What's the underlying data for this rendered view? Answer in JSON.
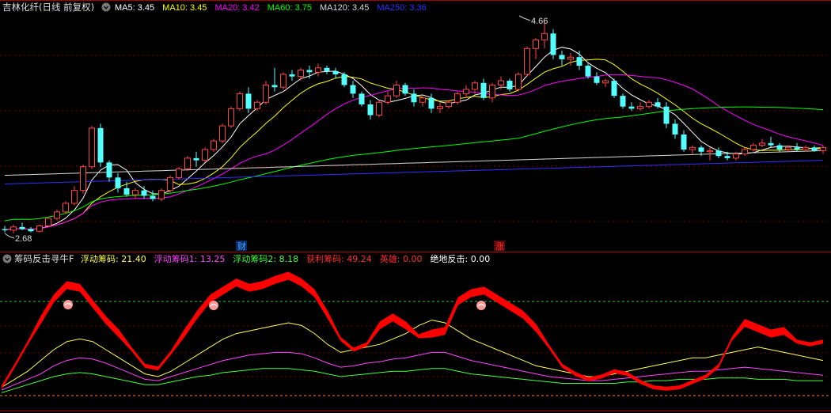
{
  "main_panel": {
    "title": "吉林化纤(日线 前复权)",
    "ma_legend": [
      {
        "label": "MA5: ",
        "value": "3.45",
        "color": "#ffffff"
      },
      {
        "label": "MA10: ",
        "value": "3.45",
        "color": "#ffff00"
      },
      {
        "label": "MA20: ",
        "value": "3.42",
        "color": "#ff00ff"
      },
      {
        "label": "MA60: ",
        "value": "3.75",
        "color": "#00ff00"
      },
      {
        "label": "MA120: ",
        "value": "3.45",
        "color": "#d8d8d8"
      },
      {
        "label": "MA250: ",
        "value": "3.36",
        "color": "#3030ff"
      }
    ],
    "high_label": "4.66",
    "low_label": "2.68",
    "markers": [
      {
        "text": "财",
        "color": "#44aaff"
      },
      {
        "text": "涨",
        "color": "#ff3030"
      }
    ]
  },
  "sub_panel": {
    "title": "筹码反击寻牛F",
    "legend": [
      {
        "label": "浮动筹码: ",
        "value": "21.40",
        "color": "#ffff55"
      },
      {
        "label": "浮动筹码1: ",
        "value": "13.25",
        "color": "#ff44ff"
      },
      {
        "label": "浮动筹码2: ",
        "value": "8.18",
        "color": "#44ff44"
      },
      {
        "label": "获利筹码: ",
        "value": "49.24",
        "color": "#ff3030"
      },
      {
        "label": "英雄: ",
        "value": "0.00",
        "color": "#ff3030"
      },
      {
        "label": "绝地反击: ",
        "value": "0.00",
        "color": "#ffffff"
      }
    ]
  },
  "colors": {
    "up": "#ff4444",
    "down": "#54ffff",
    "grid": "#7a0000",
    "profit": "#ff0000",
    "level_line": "#22cc22",
    "base_line": "#ff8800"
  },
  "chart_data": [
    {
      "type": "candlestick",
      "title": "吉林化纤(日线 前复权)",
      "price_max": 4.66,
      "price_min": 2.68,
      "ohlc": [
        [
          2.72,
          2.75,
          2.69,
          2.71
        ],
        [
          2.71,
          2.76,
          2.68,
          2.74
        ],
        [
          2.74,
          2.78,
          2.71,
          2.72
        ],
        [
          2.72,
          2.74,
          2.69,
          2.7
        ],
        [
          2.7,
          2.76,
          2.69,
          2.75
        ],
        [
          2.75,
          2.83,
          2.74,
          2.82
        ],
        [
          2.82,
          2.9,
          2.8,
          2.88
        ],
        [
          2.88,
          2.98,
          2.86,
          2.96
        ],
        [
          2.96,
          3.12,
          2.94,
          3.08
        ],
        [
          3.08,
          3.32,
          3.05,
          3.3
        ],
        [
          3.3,
          3.68,
          3.28,
          3.66
        ],
        [
          3.66,
          3.7,
          3.3,
          3.34
        ],
        [
          3.34,
          3.36,
          3.16,
          3.2
        ],
        [
          3.2,
          3.24,
          3.06,
          3.1
        ],
        [
          3.1,
          3.16,
          3.02,
          3.04
        ],
        [
          3.04,
          3.1,
          3.0,
          3.08
        ],
        [
          3.08,
          3.12,
          3.0,
          3.03
        ],
        [
          3.03,
          3.08,
          2.98,
          3.0
        ],
        [
          3.0,
          3.1,
          2.98,
          3.08
        ],
        [
          3.08,
          3.22,
          3.06,
          3.2
        ],
        [
          3.2,
          3.3,
          3.18,
          3.28
        ],
        [
          3.28,
          3.4,
          3.26,
          3.38
        ],
        [
          3.38,
          3.44,
          3.3,
          3.36
        ],
        [
          3.36,
          3.48,
          3.34,
          3.46
        ],
        [
          3.46,
          3.56,
          3.44,
          3.54
        ],
        [
          3.54,
          3.7,
          3.52,
          3.68
        ],
        [
          3.68,
          3.86,
          3.66,
          3.84
        ],
        [
          3.84,
          4.0,
          3.82,
          3.98
        ],
        [
          3.98,
          4.04,
          3.8,
          3.84
        ],
        [
          3.84,
          3.92,
          3.82,
          3.9
        ],
        [
          3.9,
          4.1,
          3.88,
          4.06
        ],
        [
          4.06,
          4.22,
          4.0,
          4.04
        ],
        [
          4.04,
          4.18,
          4.02,
          4.16
        ],
        [
          4.16,
          4.2,
          4.1,
          4.14
        ],
        [
          4.14,
          4.22,
          4.1,
          4.2
        ],
        [
          4.2,
          4.24,
          4.12,
          4.18
        ],
        [
          4.18,
          4.26,
          4.14,
          4.22
        ],
        [
          4.22,
          4.24,
          4.16,
          4.19
        ],
        [
          4.19,
          4.22,
          4.12,
          4.16
        ],
        [
          4.16,
          4.18,
          4.04,
          4.06
        ],
        [
          4.06,
          4.1,
          3.94,
          3.98
        ],
        [
          3.98,
          4.0,
          3.86,
          3.88
        ],
        [
          3.88,
          3.92,
          3.74,
          3.78
        ],
        [
          3.78,
          3.92,
          3.76,
          3.9
        ],
        [
          3.9,
          4.0,
          3.88,
          3.96
        ],
        [
          3.96,
          4.1,
          3.94,
          4.06
        ],
        [
          4.06,
          4.08,
          3.96,
          3.98
        ],
        [
          3.98,
          4.02,
          3.86,
          3.9
        ],
        [
          3.9,
          3.96,
          3.86,
          3.94
        ],
        [
          3.94,
          3.98,
          3.8,
          3.84
        ],
        [
          3.84,
          3.9,
          3.8,
          3.86
        ],
        [
          3.86,
          3.92,
          3.84,
          3.9
        ],
        [
          3.9,
          4.0,
          3.88,
          3.98
        ],
        [
          3.98,
          4.06,
          3.94,
          4.02
        ],
        [
          4.02,
          4.1,
          3.98,
          4.08
        ],
        [
          4.08,
          4.12,
          3.92,
          3.94
        ],
        [
          3.94,
          4.08,
          3.9,
          4.06
        ],
        [
          4.06,
          4.14,
          4.02,
          4.1
        ],
        [
          4.1,
          4.12,
          4.0,
          4.02
        ],
        [
          4.02,
          4.18,
          4.0,
          4.16
        ],
        [
          4.16,
          4.42,
          4.14,
          4.4
        ],
        [
          4.4,
          4.5,
          4.3,
          4.48
        ],
        [
          4.48,
          4.66,
          4.4,
          4.54
        ],
        [
          4.54,
          4.58,
          4.3,
          4.34
        ],
        [
          4.34,
          4.38,
          4.24,
          4.3
        ],
        [
          4.3,
          4.36,
          4.24,
          4.32
        ],
        [
          4.32,
          4.38,
          4.2,
          4.24
        ],
        [
          4.24,
          4.26,
          4.12,
          4.14
        ],
        [
          4.14,
          4.18,
          4.06,
          4.08
        ],
        [
          4.08,
          4.12,
          4.04,
          4.1
        ],
        [
          4.1,
          4.12,
          3.94,
          3.96
        ],
        [
          3.96,
          3.98,
          3.84,
          3.86
        ],
        [
          3.86,
          3.9,
          3.82,
          3.84
        ],
        [
          3.84,
          3.9,
          3.82,
          3.86
        ],
        [
          3.86,
          3.92,
          3.84,
          3.9
        ],
        [
          3.9,
          3.94,
          3.84,
          3.86
        ],
        [
          3.86,
          3.9,
          3.66,
          3.7
        ],
        [
          3.7,
          3.74,
          3.56,
          3.6
        ],
        [
          3.6,
          3.64,
          3.44,
          3.46
        ],
        [
          3.46,
          3.5,
          3.42,
          3.48
        ],
        [
          3.48,
          3.5,
          3.4,
          3.44
        ],
        [
          3.44,
          3.48,
          3.36,
          3.45
        ],
        [
          3.45,
          3.48,
          3.38,
          3.4
        ],
        [
          3.4,
          3.44,
          3.36,
          3.38
        ],
        [
          3.38,
          3.44,
          3.36,
          3.42
        ],
        [
          3.42,
          3.48,
          3.4,
          3.46
        ],
        [
          3.46,
          3.52,
          3.44,
          3.5
        ],
        [
          3.5,
          3.56,
          3.48,
          3.52
        ],
        [
          3.52,
          3.58,
          3.48,
          3.5
        ],
        [
          3.5,
          3.52,
          3.44,
          3.46
        ],
        [
          3.46,
          3.5,
          3.44,
          3.48
        ],
        [
          3.48,
          3.52,
          3.44,
          3.46
        ],
        [
          3.46,
          3.5,
          3.44,
          3.48
        ],
        [
          3.48,
          3.5,
          3.44,
          3.45
        ],
        [
          3.45,
          3.5,
          3.42,
          3.48
        ]
      ],
      "ma_current": {
        "MA5": 3.45,
        "MA10": 3.45,
        "MA20": 3.42,
        "MA60": 3.75,
        "MA120": 3.45,
        "MA250": 3.36
      }
    },
    {
      "type": "line",
      "title": "筹码反击寻牛F",
      "ylim": [
        0,
        100
      ],
      "reference_levels": [
        75,
        12
      ],
      "series": [
        {
          "name": "获利筹码",
          "color": "#ff0000",
          "values": [
            12,
            28,
            45,
            62,
            78,
            88,
            86,
            74,
            62,
            52,
            40,
            28,
            26,
            38,
            52,
            66,
            78,
            84,
            90,
            86,
            88,
            92,
            95,
            90,
            82,
            66,
            48,
            40,
            44,
            58,
            64,
            58,
            50,
            52,
            54,
            76,
            82,
            84,
            78,
            72,
            66,
            56,
            42,
            28,
            22,
            18,
            20,
            24,
            22,
            16,
            12,
            11,
            12,
            16,
            20,
            28,
            48,
            60,
            56,
            52,
            54,
            46,
            44,
            46
          ]
        },
        {
          "name": "浮动筹码",
          "color": "#ffff55",
          "values": [
            12,
            18,
            24,
            32,
            40,
            46,
            48,
            46,
            40,
            34,
            28,
            22,
            20,
            24,
            30,
            36,
            42,
            48,
            52,
            54,
            56,
            58,
            60,
            58,
            52,
            44,
            38,
            40,
            42,
            44,
            48,
            52,
            58,
            62,
            60,
            54,
            48,
            44,
            40,
            36,
            32,
            28,
            26,
            24,
            22,
            20,
            20,
            22,
            24,
            26,
            28,
            30,
            32,
            34,
            34,
            36,
            38,
            40,
            42,
            40,
            38,
            36,
            34,
            32
          ]
        },
        {
          "name": "浮动筹码1",
          "color": "#ff44ff",
          "values": [
            10,
            14,
            18,
            22,
            28,
            32,
            34,
            33,
            30,
            26,
            22,
            18,
            17,
            20,
            23,
            26,
            29,
            32,
            34,
            36,
            37,
            38,
            38,
            37,
            34,
            30,
            27,
            28,
            30,
            31,
            33,
            34,
            36,
            38,
            38,
            35,
            32,
            30,
            28,
            26,
            24,
            22,
            20,
            19,
            18,
            17,
            17,
            18,
            19,
            20,
            21,
            22,
            23,
            24,
            24,
            25,
            26,
            27,
            26,
            25,
            24,
            23,
            22,
            21
          ]
        },
        {
          "name": "浮动筹码2",
          "color": "#44ff44",
          "values": [
            8,
            11,
            14,
            17,
            20,
            22,
            23,
            22,
            20,
            18,
            16,
            14,
            14,
            16,
            18,
            20,
            21,
            23,
            24,
            25,
            26,
            26,
            26,
            25,
            24,
            22,
            20,
            21,
            22,
            23,
            24,
            24,
            25,
            26,
            26,
            24,
            22,
            21,
            20,
            19,
            18,
            17,
            16,
            15,
            15,
            15,
            15,
            15,
            16,
            16,
            17,
            17,
            18,
            18,
            18,
            19,
            19,
            19,
            18,
            18,
            18,
            17,
            17,
            17
          ]
        }
      ]
    }
  ]
}
